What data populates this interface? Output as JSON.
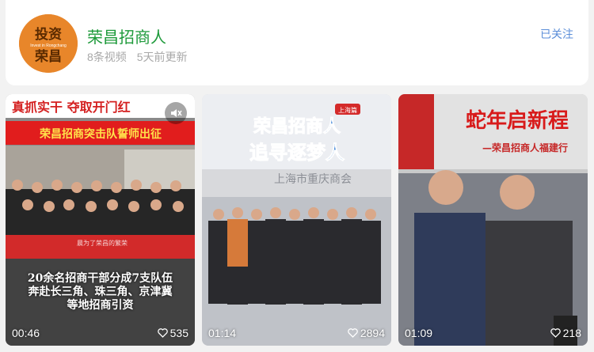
{
  "header": {
    "logo": {
      "line1": "投资",
      "line2": "荣昌",
      "sub": "Invest in Rongchang"
    },
    "title": "荣昌招商人",
    "video_count": "8条视频",
    "updated": "5天前更新",
    "follow_label": "已关注"
  },
  "videos": [
    {
      "banner1": "真抓实干 夺取开门红",
      "banner2": "荣昌招商突击队誓师出征",
      "small_label": "晨为了荣昌的繁荣",
      "caption_lines": [
        "20余名招商干部分成7支队伍",
        "奔赴长三角、珠三角、京津冀",
        "等地招商引资"
      ],
      "duration": "00:46",
      "likes": "535"
    },
    {
      "tag": "上海篇",
      "title1": "荣昌招商人",
      "title2": "追寻逐梦人",
      "wall_text": "上海市重庆商会",
      "duration": "01:14",
      "likes": "2894"
    },
    {
      "title": "蛇年启新程",
      "subtitle": "—荣昌招商人福建行",
      "duration": "01:09",
      "likes": "218"
    }
  ],
  "colors": {
    "accent_green": "#1d9a3a",
    "follow_blue": "#5b8ed8",
    "logo_orange": "#e8862a"
  }
}
